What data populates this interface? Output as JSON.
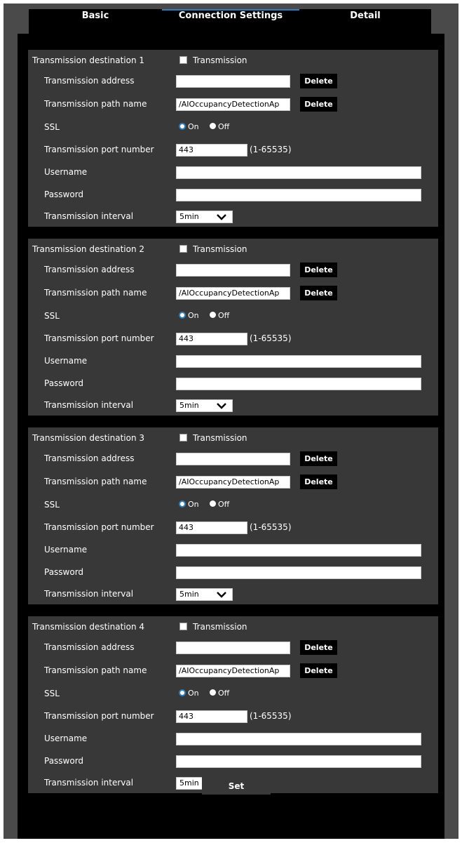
{
  "tabs": [
    {
      "label": "Basic"
    },
    {
      "label": "Connection Settings"
    },
    {
      "label": "Detail"
    }
  ],
  "labels": {
    "transmission_checkbox": "Transmission",
    "address": "Transmission address",
    "path": "Transmission path name",
    "ssl": "SSL",
    "port": "Transmission port number",
    "username": "Username",
    "password": "Password",
    "interval": "Transmission interval",
    "delete": "Delete",
    "ssl_on": "On",
    "ssl_off": "Off",
    "port_range": "(1-65535)"
  },
  "destinations": [
    {
      "title": "Transmission destination 1",
      "transmission_checked": false,
      "address": "",
      "path": "/AIOccupancyDetectionAp",
      "ssl": "On",
      "port": "443",
      "username": "",
      "password": "",
      "interval": "5min"
    },
    {
      "title": "Transmission destination 2",
      "transmission_checked": false,
      "address": "",
      "path": "/AIOccupancyDetectionAp",
      "ssl": "On",
      "port": "443",
      "username": "",
      "password": "",
      "interval": "5min"
    },
    {
      "title": "Transmission destination 3",
      "transmission_checked": false,
      "address": "",
      "path": "/AIOccupancyDetectionAp",
      "ssl": "On",
      "port": "443",
      "username": "",
      "password": "",
      "interval": "5min"
    },
    {
      "title": "Transmission destination 4",
      "transmission_checked": false,
      "address": "",
      "path": "/AIOccupancyDetectionAp",
      "ssl": "On",
      "port": "443",
      "username": "",
      "password": "",
      "interval": "5min"
    }
  ],
  "set_button": "Set",
  "colors": {
    "active_tab_accent": "#2e7fbf",
    "section_bg": "#383838",
    "frame_bg": "#4a4a4a"
  }
}
